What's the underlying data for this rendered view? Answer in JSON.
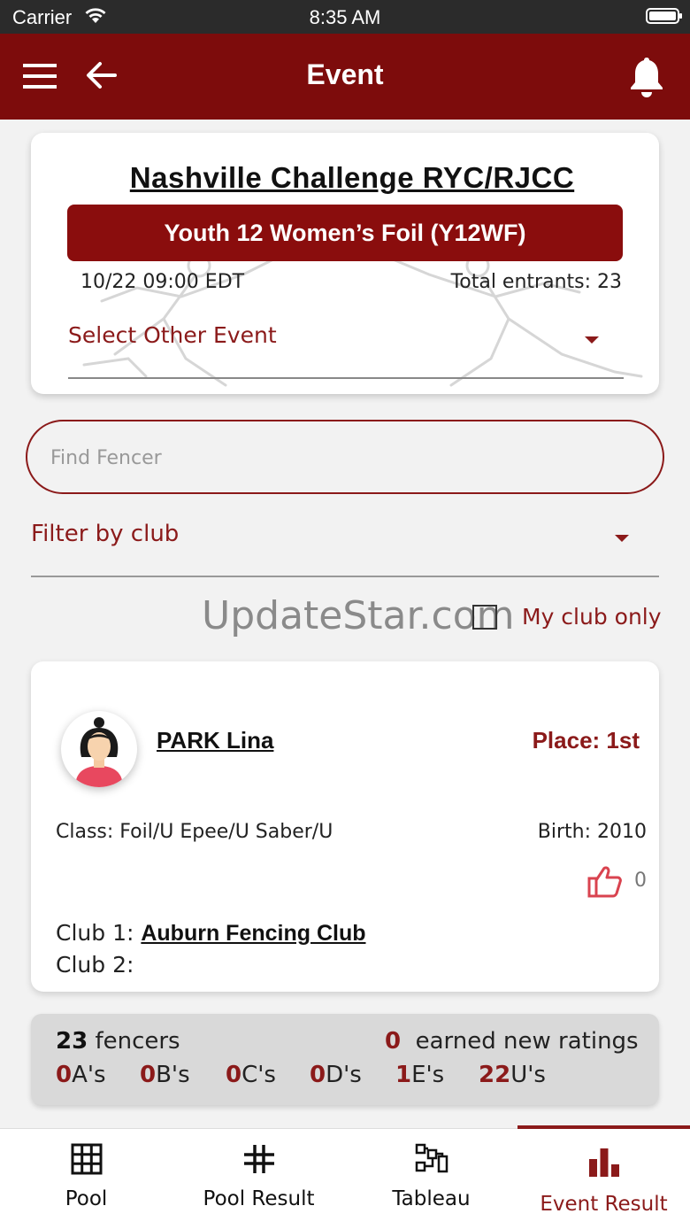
{
  "status_bar": {
    "carrier": "Carrier",
    "time": "8:35 AM"
  },
  "header": {
    "title": "Event",
    "accent_color": "#7d0c0c"
  },
  "event": {
    "name": "Nashville Challenge RYC/RJCC",
    "badge": "Youth 12 Women’s Foil (Y12WF)",
    "date": "10/22 09:00 EDT",
    "entrants": "Total entrants: 23",
    "select_other": "Select Other Event"
  },
  "search": {
    "placeholder": "Find Fencer"
  },
  "filter": {
    "label": "Filter by club"
  },
  "watermark": "UpdateStar.com",
  "my_club_only": {
    "label": "My club only",
    "checked": false
  },
  "fencer": {
    "name": "PARK Lina",
    "place": "Place: 1st",
    "class": "Class: Foil/U Epee/U Saber/U",
    "birth": "Birth: 2010",
    "likes": "0",
    "club1_label": "Club 1:",
    "club1": "Auburn Fencing Club",
    "club2_label": "Club 2:"
  },
  "stats": {
    "fencers_count": "23",
    "fencers_label": "fencers",
    "new_ratings_count": "0",
    "new_ratings_label": "earned new ratings",
    "ratings": [
      {
        "count": "0",
        "label": "A's"
      },
      {
        "count": "0",
        "label": "B's"
      },
      {
        "count": "0",
        "label": "C's"
      },
      {
        "count": "0",
        "label": "D's"
      },
      {
        "count": "1",
        "label": "E's"
      },
      {
        "count": "22",
        "label": "U's"
      }
    ]
  },
  "tabs": [
    {
      "label": "Pool",
      "icon": "grid-icon"
    },
    {
      "label": "Pool Result",
      "icon": "hash-icon"
    },
    {
      "label": "Tableau",
      "icon": "bracket-icon"
    },
    {
      "label": "Event Result",
      "icon": "bar-chart-icon",
      "active": true
    }
  ]
}
